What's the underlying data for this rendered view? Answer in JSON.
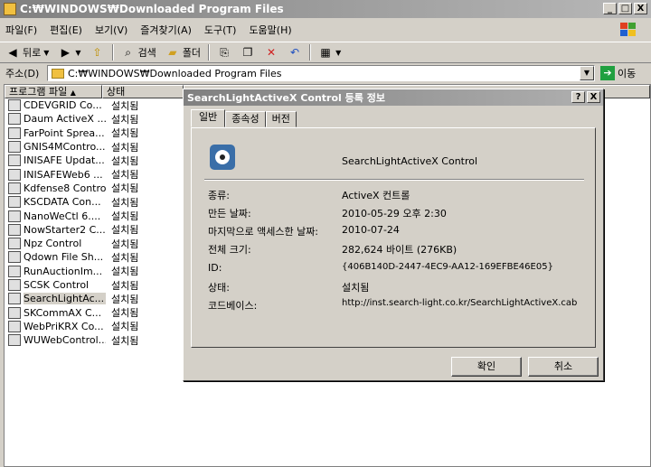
{
  "window": {
    "title": "C:₩WINDOWS₩Downloaded Program Files",
    "minimize": "_",
    "maximize": "□",
    "close": "X"
  },
  "menu": [
    "파일(F)",
    "편집(E)",
    "보기(V)",
    "즐겨찾기(A)",
    "도구(T)",
    "도움말(H)"
  ],
  "toolbar": {
    "back": "뒤로",
    "search": "검색",
    "folders": "폴더"
  },
  "address": {
    "label": "주소(D)",
    "value": "C:₩WINDOWS₩Downloaded Program Files",
    "go": "이동"
  },
  "list": {
    "columns": [
      "프로그램 파일",
      "상태"
    ],
    "rows": [
      {
        "name": "CDEVGRID Co...",
        "status": "설치됨"
      },
      {
        "name": "Daum ActiveX ...",
        "status": "설치됨"
      },
      {
        "name": "FarPoint Sprea...",
        "status": "설치됨"
      },
      {
        "name": "GNIS4MContro...",
        "status": "설치됨"
      },
      {
        "name": "INISAFE Updat...",
        "status": "설치됨"
      },
      {
        "name": "INISAFEWeb6 ...",
        "status": "설치됨"
      },
      {
        "name": "Kdfense8 Control",
        "status": "설치됨"
      },
      {
        "name": "KSCDATA Con...",
        "status": "설치됨"
      },
      {
        "name": "NanoWeCtl 6....",
        "status": "설치됨"
      },
      {
        "name": "NowStarter2 C...",
        "status": "설치됨"
      },
      {
        "name": "Npz Control",
        "status": "설치됨"
      },
      {
        "name": "Qdown File Sh...",
        "status": "설치됨"
      },
      {
        "name": "RunAuctionIm...",
        "status": "설치됨"
      },
      {
        "name": "SCSK Control",
        "status": "설치됨"
      },
      {
        "name": "SearchLightAc...",
        "status": "설치됨"
      },
      {
        "name": "SKCommAX C...",
        "status": "설치됨"
      },
      {
        "name": "WebPriKRX Co...",
        "status": "설치됨"
      },
      {
        "name": "WUWebControl...",
        "status": "설치됨"
      }
    ]
  },
  "dialog": {
    "title": "SearchLightActiveX Control 등록 정보",
    "help": "?",
    "close": "X",
    "tabs": [
      "일반",
      "종속성",
      "버전"
    ],
    "control_name": "SearchLightActiveX Control",
    "props": [
      {
        "key": "종류:",
        "value": "ActiveX 컨트롤"
      },
      {
        "key": "만든 날짜:",
        "value": "2010-05-29 오후 2:30"
      },
      {
        "key": "마지막으로 액세스한 날짜:",
        "value": "2010-07-24"
      },
      {
        "key": "전체 크기:",
        "value": "282,624 바이트 (276KB)"
      },
      {
        "key": "ID:",
        "value": "{406B140D-2447-4EC9-AA12-169EFBE46E05}"
      },
      {
        "key": "상태:",
        "value": "설치됨"
      },
      {
        "key": "코드베이스:",
        "value": "http://inst.search-light.co.kr/SearchLightActiveX.cab"
      }
    ],
    "ok": "확인",
    "cancel": "취소"
  }
}
